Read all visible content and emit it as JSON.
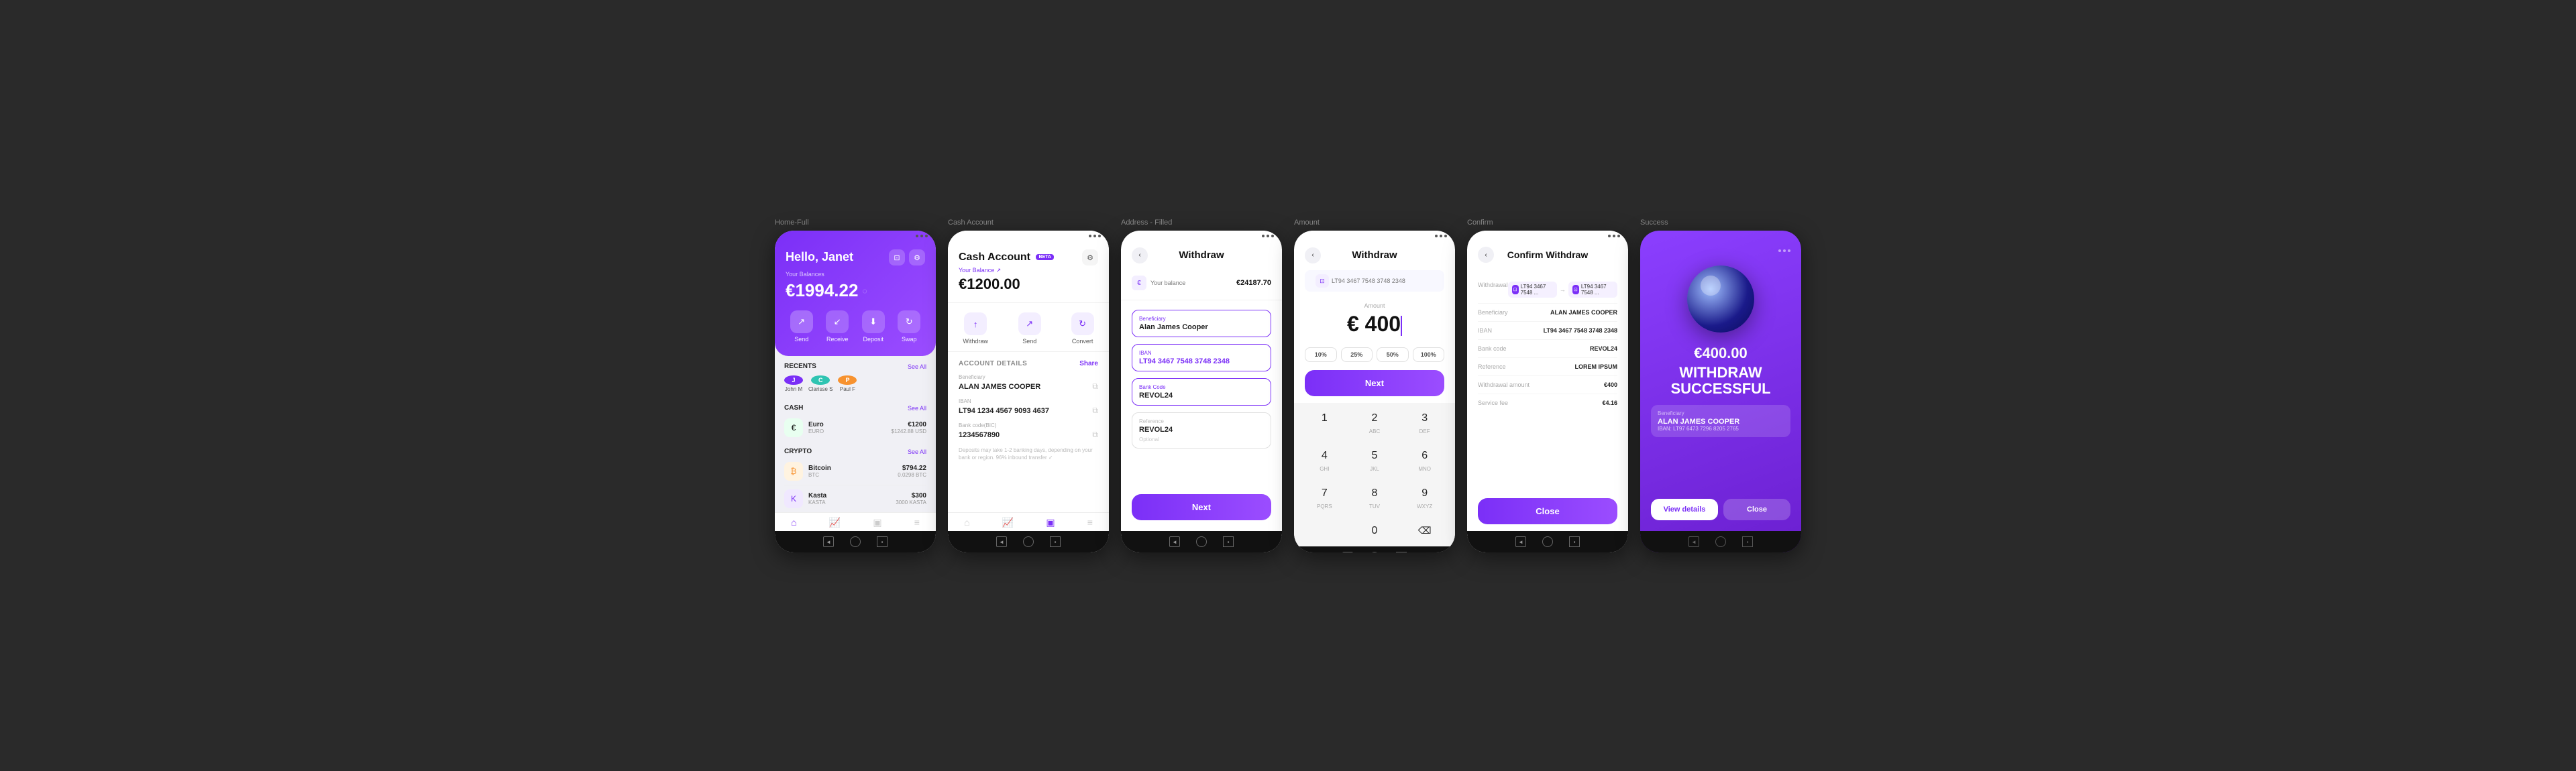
{
  "screens": [
    {
      "id": "home-full",
      "label": "Home-Full",
      "header": {
        "greeting": "Hello, Janet",
        "balance_label": "Your Balances",
        "balance": "€1994.22"
      },
      "actions": [
        "Send",
        "Receive",
        "Deposit",
        "Swap"
      ],
      "sections": {
        "recents": {
          "title": "RECENTS",
          "see_all": "See All",
          "items": [
            {
              "initials": "J",
              "name": "John M",
              "color": "#7b2ff7"
            },
            {
              "initials": "C",
              "name": "Clarisse S",
              "color": "#2fc4b2"
            },
            {
              "initials": "P",
              "name": "Paul F",
              "color": "#f7922f"
            }
          ]
        },
        "cash": {
          "title": "CASH",
          "see_all": "See All",
          "items": [
            {
              "icon": "€",
              "name": "Euro",
              "sub": "EURO",
              "amount": "€1200",
              "sub2": "$1242.88 USD",
              "color": "#2ecc71"
            }
          ]
        },
        "crypto": {
          "title": "CRYPTO",
          "see_all": "See All",
          "items": [
            {
              "icon": "₿",
              "name": "Bitcoin",
              "sub": "BTC",
              "amount": "$794.22",
              "sub2": "0.0298 BTC",
              "color": "#f7922f"
            },
            {
              "icon": "K",
              "name": "Kasta",
              "sub": "KASTA",
              "amount": "$300",
              "sub2": "3000 KASTA",
              "color": "#7b2ff7"
            }
          ]
        }
      }
    },
    {
      "id": "cash-account",
      "label": "Cash Account",
      "title": "Cash Account",
      "beta": "BETA",
      "balance_label": "Your Balance ↗",
      "balance": "€1200.00",
      "actions": [
        "Withdraw",
        "Send",
        "Convert"
      ],
      "account_details": {
        "title": "ACCOUNT DETAILS",
        "share": "Share",
        "beneficiary_label": "Beneficiary",
        "beneficiary": "ALAN JAMES COOPER",
        "iban_label": "IBAN",
        "iban": "LT94 1234 4567 9093 4637",
        "bank_label": "Bank code(BIC)",
        "bank": "1234567890",
        "note": "Deposits may take 1-2 banking days, depending on your bank or region. 96% inbound transfer ✓"
      }
    },
    {
      "id": "address-filled",
      "label": "Address - Filled",
      "title": "Withdraw",
      "balance_label": "Your balance",
      "balance": "€24187.70",
      "form": {
        "beneficiary_label": "Beneficiary",
        "beneficiary": "Alan James Cooper",
        "iban_label": "IBAN",
        "iban": "LT94 3467 7548 3748 2348",
        "bank_label": "Bank Code",
        "bank": "REVOL24",
        "reference_label": "Reference",
        "reference": "REVOL24",
        "optional": "Optional"
      },
      "next_btn": "Next"
    },
    {
      "id": "amount",
      "label": "Amount",
      "title": "Withdraw",
      "iban": "LT94 3467 7548 3748 2348",
      "amount_label": "Amount",
      "amount": "€ 400",
      "percentages": [
        "10%",
        "25%",
        "50%",
        "100%"
      ],
      "next_btn": "Next",
      "numpad": [
        "1",
        "2",
        "3",
        "4",
        "5",
        "6",
        "7",
        "8",
        "9",
        "",
        "0",
        "⌫"
      ],
      "numpad_labels": [
        "",
        "ABC",
        "DEF",
        "GHI",
        "JKL",
        "MNO",
        "PQRS",
        "TUV",
        "WXYZ",
        "",
        "",
        ""
      ]
    },
    {
      "id": "confirm",
      "label": "Confirm",
      "title": "Confirm Withdraw",
      "withdrawal_label": "Withdrawal",
      "from_iban": "LT94 3467 7548 ...",
      "to_iban": "LT94 3467 7548 ...",
      "fields": [
        {
          "label": "Beneficiary",
          "value": "ALAN JAMES COOPER"
        },
        {
          "label": "IBAN",
          "value": "LT94 3467 7548 3748 2348"
        },
        {
          "label": "Bank code",
          "value": "REVOL24"
        },
        {
          "label": "Reference",
          "value": "LOREM IPSUM"
        },
        {
          "label": "Withdrawal amount",
          "value": "€400"
        },
        {
          "label": "Service fee",
          "value": "€4.16"
        }
      ],
      "close_btn": "Close"
    },
    {
      "id": "success",
      "label": "Success",
      "amount": "€400.00",
      "title": "WITHDRAW\nSUCCESSFUL",
      "beneficiary_label": "Beneficiary",
      "beneficiary_name": "ALAN JAMES COOPER",
      "beneficiary_iban": "IBAN: LT97 6473 7296 8205 2765",
      "btn_view": "View details",
      "btn_close": "Close"
    }
  ],
  "icons": {
    "send": "↗",
    "receive": "↙",
    "deposit": "⬇",
    "swap": "↻",
    "back": "‹",
    "copy": "⧉",
    "eye_off": "◌",
    "gear": "⚙",
    "scan": "⊡",
    "home": "⌂",
    "chart": "📈",
    "wallet": "▣",
    "settings": "≡"
  }
}
